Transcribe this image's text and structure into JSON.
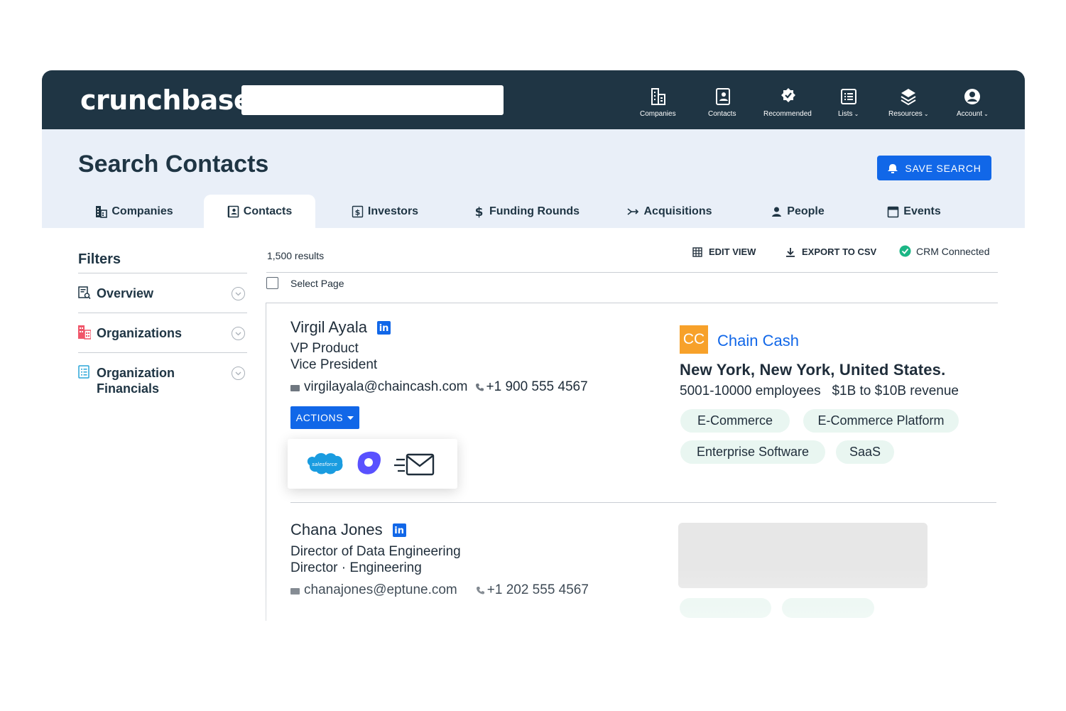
{
  "topbar": {
    "logo": "crunchbase",
    "search_value": "",
    "nav": [
      {
        "label": "Companies",
        "icon": "building-icon",
        "caret": ""
      },
      {
        "label": "Contacts",
        "icon": "contact-card-icon",
        "caret": ""
      },
      {
        "label": "Recommended",
        "icon": "badge-check-icon",
        "caret": ""
      },
      {
        "label": "Lists",
        "icon": "list-icon",
        "caret": "⌄"
      },
      {
        "label": "Resources",
        "icon": "layers-icon",
        "caret": "⌄"
      },
      {
        "label": "Account",
        "icon": "account-circle-icon",
        "caret": "⌄"
      }
    ]
  },
  "header": {
    "title": "Search Contacts",
    "save_label": "SAVE SEARCH"
  },
  "tabs": [
    {
      "label": "Companies",
      "icon": "building-icon"
    },
    {
      "label": "Contacts",
      "icon": "contact-card-icon",
      "active": true
    },
    {
      "label": "Investors",
      "icon": "dollar-box-icon"
    },
    {
      "label": "Funding Rounds",
      "icon": "dollar-icon"
    },
    {
      "label": "Acquisitions",
      "icon": "merge-arrow-icon"
    },
    {
      "label": "People",
      "icon": "person-icon"
    },
    {
      "label": "Events",
      "icon": "calendar-icon"
    }
  ],
  "filters": {
    "title": "Filters",
    "items": [
      {
        "label": "Overview",
        "icon": "overview-search-icon"
      },
      {
        "label": "Organizations",
        "icon": "organizations-icon"
      },
      {
        "label": "Organization Financials",
        "icon": "financials-doc-icon"
      }
    ]
  },
  "results": {
    "count": "1,500 results",
    "edit_view": "EDIT VIEW",
    "export": "EXPORT TO CSV",
    "crm": "CRM Connected",
    "select_page": "Select Page"
  },
  "contacts": [
    {
      "name": "Virgil Ayala",
      "title": "VP Product",
      "role": "Vice President",
      "email": "virgilayala@chaincash.com",
      "phone": "+1 900 555 4567",
      "actions_label": "ACTIONS",
      "action_menu": [
        "salesforce",
        "outreach",
        "email"
      ],
      "company": {
        "initials": "CC",
        "name": "Chain Cash",
        "location": "New York, New York, United States.",
        "employees": "5001-10000 employees",
        "revenue": "$1B to $10B revenue",
        "tags": [
          "E-Commerce",
          "E-Commerce Platform",
          "Enterprise Software",
          "SaaS"
        ]
      }
    },
    {
      "name": "Chana Jones",
      "title": "Director of Data Engineering",
      "role": "Director · Engineering",
      "email": "chanajones@eptune.com",
      "phone": "+1 202 555 4567"
    }
  ],
  "colors": {
    "nav_bg": "#1f3544",
    "header_bg": "#e9eff8",
    "accent": "#1167e8",
    "tag_bg": "#e9f6f1",
    "company_logo": "#f7a12a",
    "crm_ok": "#1bb685"
  }
}
